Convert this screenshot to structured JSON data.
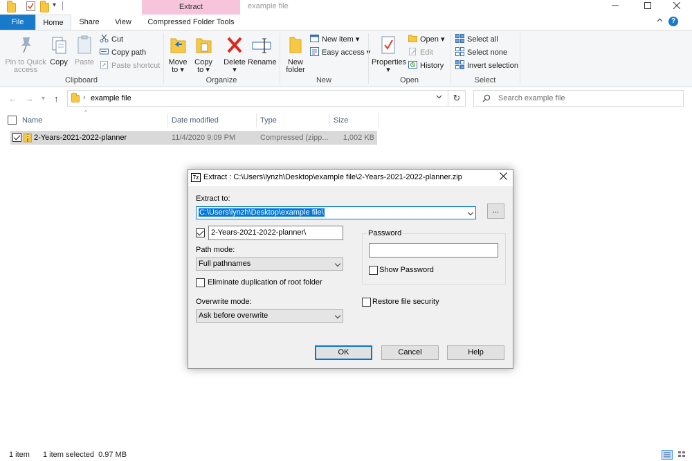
{
  "window": {
    "title": "example file",
    "context_tab": "Extract"
  },
  "ribbon_tabs": {
    "file": "File",
    "home": "Home",
    "share": "Share",
    "view": "View",
    "compressed": "Compressed Folder Tools"
  },
  "ribbon": {
    "clipboard": {
      "label": "Clipboard",
      "pin": "Pin to Quick\naccess",
      "copy": "Copy",
      "paste": "Paste",
      "cut": "Cut",
      "copy_path": "Copy path",
      "paste_shortcut": "Paste shortcut"
    },
    "organize": {
      "label": "Organize",
      "move_to": "Move\nto ▾",
      "copy_to": "Copy\nto ▾",
      "delete": "Delete\n▾",
      "rename": "Rename"
    },
    "new": {
      "label": "New",
      "new_folder": "New\nfolder",
      "new_item": "New item ▾",
      "easy_access": "Easy access ▾"
    },
    "open": {
      "label": "Open",
      "properties": "Properties\n▾",
      "open": "Open ▾",
      "edit": "Edit",
      "history": "History"
    },
    "select": {
      "label": "Select",
      "select_all": "Select all",
      "select_none": "Select none",
      "invert": "Invert selection"
    }
  },
  "address": {
    "crumb": "example file",
    "search_placeholder": "Search example file"
  },
  "list": {
    "columns": [
      "Name",
      "Date modified",
      "Type",
      "Size"
    ],
    "rows": [
      {
        "name": "2-Years-2021-2022-planner",
        "date": "11/4/2020 9:09 PM",
        "type": "Compressed (zipp...",
        "size": "1,002 KB"
      }
    ]
  },
  "status": {
    "count": "1 item",
    "selected": "1 item selected  0.97 MB"
  },
  "dialog": {
    "title": "Extract : C:\\Users\\lynzh\\Desktop\\example file\\2-Years-2021-2022-planner.zip",
    "extract_to_label": "Extract to:",
    "extract_to_value": "C:\\Users\\lynzh\\Desktop\\example file\\",
    "browse": "...",
    "subfolder_value": "2-Years-2021-2022-planner\\",
    "path_mode_label": "Path mode:",
    "path_mode_value": "Full pathnames",
    "eliminate_dup": "Eliminate duplication of root folder",
    "overwrite_label": "Overwrite mode:",
    "overwrite_value": "Ask before overwrite",
    "password_label": "Password",
    "show_password": "Show Password",
    "restore_security": "Restore file security",
    "ok": "OK",
    "cancel": "Cancel",
    "help": "Help"
  }
}
